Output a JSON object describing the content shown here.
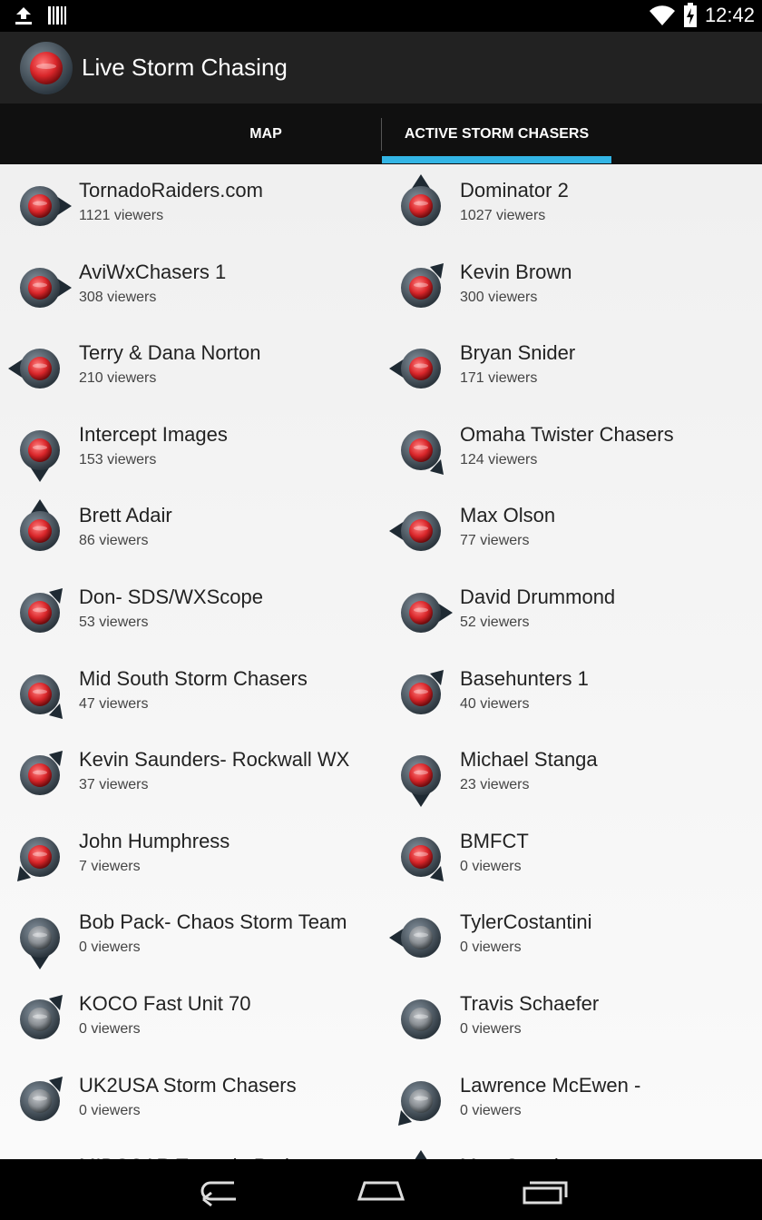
{
  "status": {
    "time": "12:42"
  },
  "app": {
    "title": "Live Storm Chasing"
  },
  "tabs": [
    {
      "label": "MAP"
    },
    {
      "label": "ACTIVE STORM CHASERS"
    }
  ],
  "colors": {
    "accent": "#33b5e5",
    "live": "#d9262a",
    "offline": "#8a8f94"
  },
  "chasers": [
    {
      "name": "TornadoRaiders.com",
      "viewers": "1121 viewers",
      "live": true,
      "pointer": "right"
    },
    {
      "name": "Dominator 2",
      "viewers": "1027 viewers",
      "live": true,
      "pointer": "up"
    },
    {
      "name": "AviWxChasers 1",
      "viewers": "308 viewers",
      "live": true,
      "pointer": "right"
    },
    {
      "name": "Kevin Brown",
      "viewers": "300 viewers",
      "live": true,
      "pointer": "upright"
    },
    {
      "name": "Terry & Dana Norton",
      "viewers": "210 viewers",
      "live": true,
      "pointer": "left"
    },
    {
      "name": "Bryan Snider",
      "viewers": "171 viewers",
      "live": true,
      "pointer": "left"
    },
    {
      "name": "Intercept Images",
      "viewers": "153 viewers",
      "live": true,
      "pointer": "down"
    },
    {
      "name": "Omaha Twister Chasers",
      "viewers": "124 viewers",
      "live": true,
      "pointer": "downright"
    },
    {
      "name": "Brett Adair",
      "viewers": "86 viewers",
      "live": true,
      "pointer": "up"
    },
    {
      "name": "Max Olson",
      "viewers": "77 viewers",
      "live": true,
      "pointer": "left"
    },
    {
      "name": "Don- SDS/WXScope",
      "viewers": "53 viewers",
      "live": true,
      "pointer": "upright"
    },
    {
      "name": "David Drummond",
      "viewers": "52 viewers",
      "live": true,
      "pointer": "right"
    },
    {
      "name": "Mid South Storm Chasers",
      "viewers": "47 viewers",
      "live": true,
      "pointer": "downright"
    },
    {
      "name": "Basehunters 1",
      "viewers": "40 viewers",
      "live": true,
      "pointer": "upright"
    },
    {
      "name": "Kevin Saunders- Rockwall  WX",
      "viewers": "37 viewers",
      "live": true,
      "pointer": "upright"
    },
    {
      "name": "Michael Stanga",
      "viewers": "23 viewers",
      "live": true,
      "pointer": "down"
    },
    {
      "name": "John Humphress",
      "viewers": "7 viewers",
      "live": true,
      "pointer": "downleft"
    },
    {
      "name": "BMFCT",
      "viewers": "0 viewers",
      "live": true,
      "pointer": "downright"
    },
    {
      "name": "Bob Pack- Chaos Storm Team",
      "viewers": "0 viewers",
      "live": false,
      "pointer": "down"
    },
    {
      "name": "TylerCostantini",
      "viewers": "0 viewers",
      "live": false,
      "pointer": "left"
    },
    {
      "name": "KOCO Fast Unit 70",
      "viewers": "0 viewers",
      "live": false,
      "pointer": "upright"
    },
    {
      "name": "Travis Schaefer",
      "viewers": "0 viewers",
      "live": false,
      "pointer": "none"
    },
    {
      "name": "UK2USA Storm Chasers",
      "viewers": "0 viewers",
      "live": false,
      "pointer": "upright"
    },
    {
      "name": "Lawrence McEwen -",
      "viewers": "0 viewers",
      "live": false,
      "pointer": "downleft"
    },
    {
      "name": "MIDSCAR Tornado Probe",
      "viewers": "",
      "live": false,
      "pointer": "none"
    },
    {
      "name": "Matt Grantham",
      "viewers": "",
      "live": false,
      "pointer": "up"
    }
  ]
}
